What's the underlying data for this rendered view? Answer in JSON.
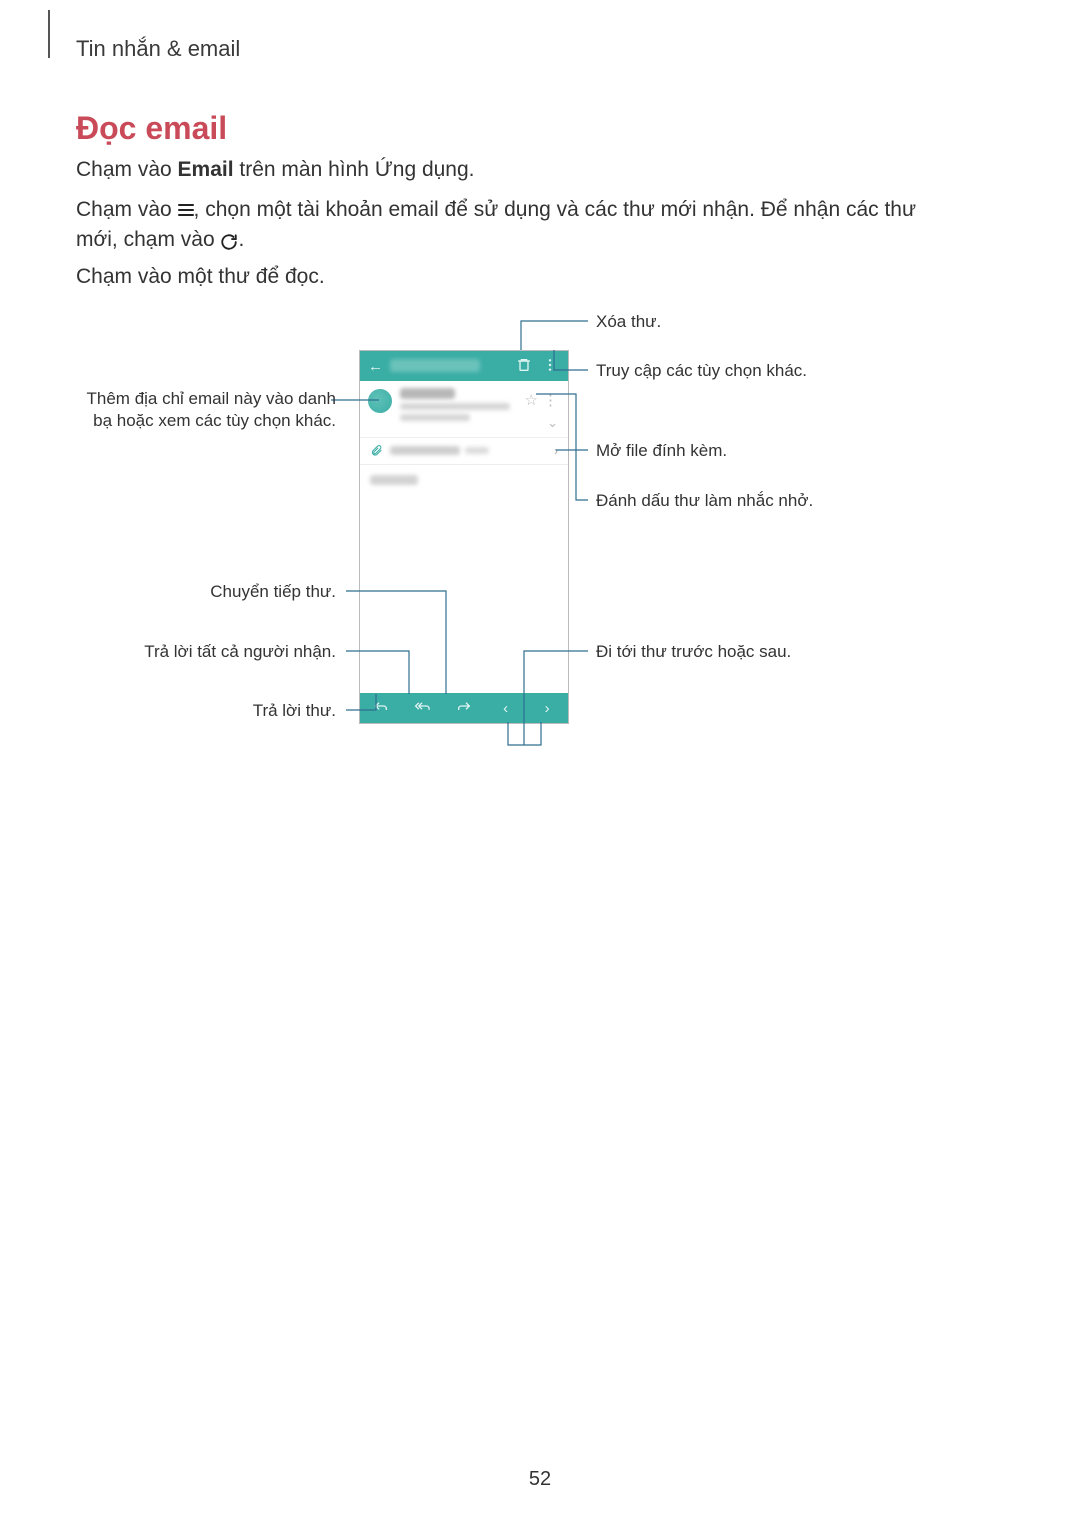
{
  "breadcrumb": "Tin nhắn & email",
  "title": "Đọc email",
  "para1_pre": "Chạm vào ",
  "para1_bold": "Email",
  "para1_post": " trên màn hình Ứng dụng.",
  "para2_seg1": "Chạm vào ",
  "para2_seg2": ", chọn một tài khoản email để sử dụng và các thư mới nhận. Để nhận các thư mới, chạm vào ",
  "para2_seg3": ".",
  "para3": "Chạm vào một thư để đọc.",
  "callouts": {
    "delete": "Xóa thư.",
    "more_options": "Truy cập các tùy chọn khác.",
    "open_attachment": "Mở file đính kèm.",
    "flag_reminder": "Đánh dấu thư làm nhắc nhở.",
    "prev_next": "Đi tới thư trước hoặc sau.",
    "add_contact": "Thêm địa chỉ email này vào danh bạ hoặc xem các tùy chọn khác.",
    "forward": "Chuyển tiếp thư.",
    "reply_all": "Trả lời tất cả người nhận.",
    "reply": "Trả lời thư."
  },
  "page_number": "52"
}
